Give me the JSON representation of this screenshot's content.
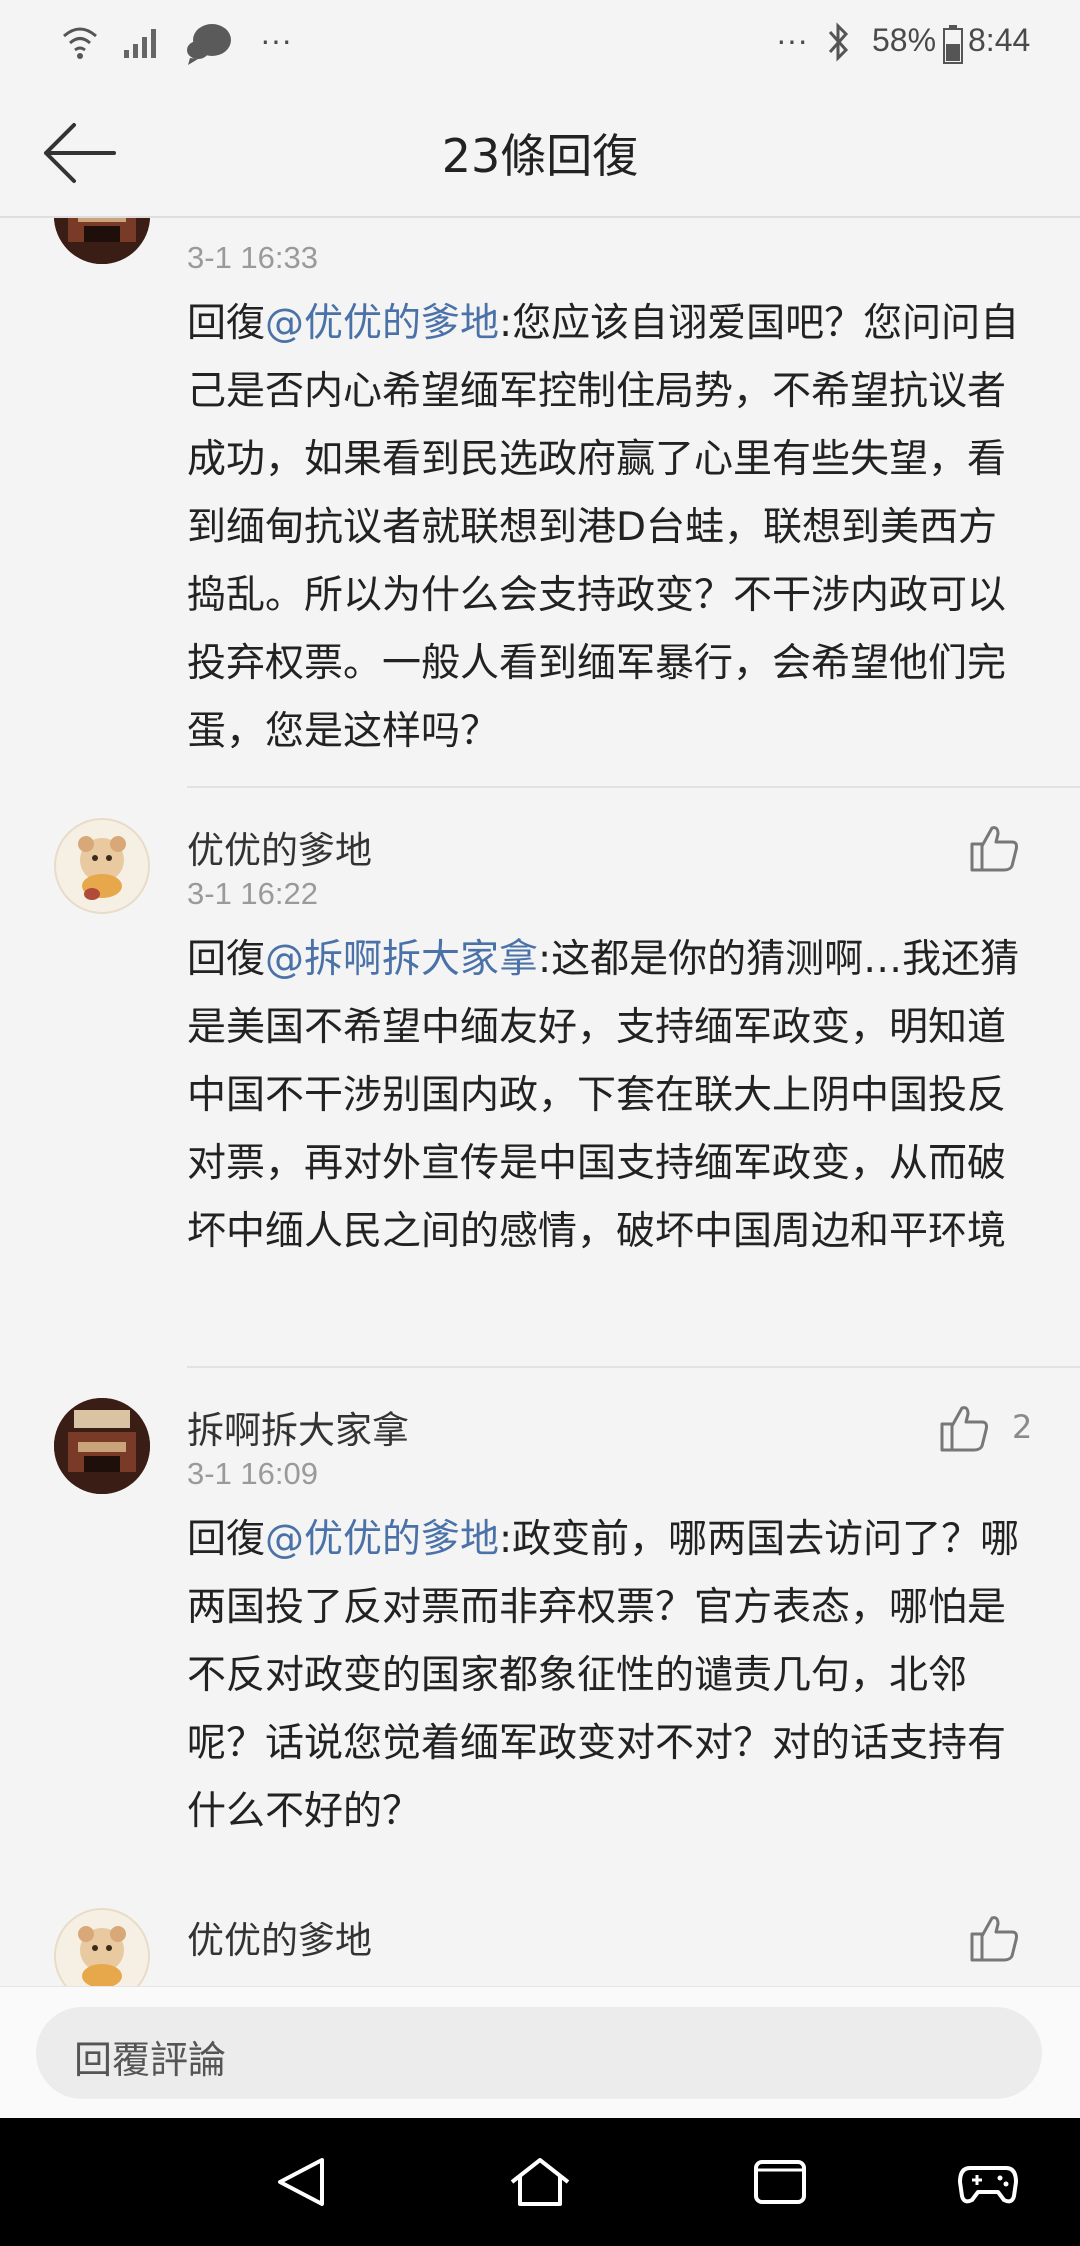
{
  "status_bar": {
    "overflow_left": "···",
    "overflow_right": "···",
    "battery": "58%",
    "time": "8:44"
  },
  "header": {
    "title": "23條回復"
  },
  "comments": [
    {
      "author": "",
      "time": "3-1 16:33",
      "reply_prefix": "回復",
      "mention": "@优优的爹地",
      "text": ":您应该自诩爱国吧？您问问自己是否内心希望缅军控制住局势，不希望抗议者成功，如果看到民选政府赢了心里有些失望，看到缅甸抗议者就联想到港D台蛙，联想到美西方捣乱。所以为什么会支持政变？不干涉内政可以投弃权票。一般人看到缅军暴行，会希望他们完蛋，您是这样吗？",
      "likes": ""
    },
    {
      "author": "优优的爹地",
      "time": "3-1 16:22",
      "reply_prefix": "回復",
      "mention": "@拆啊拆大家拿",
      "text": ":这都是你的猜测啊…我还猜是美国不希望中缅友好，支持缅军政变，明知道中国不干涉别国内政，下套在联大上阴中国投反对票，再对外宣传是中国支持缅军政变，从而破坏中缅人民之间的感情，破坏中国周边和平环境",
      "likes": ""
    },
    {
      "author": "拆啊拆大家拿",
      "time": "3-1 16:09",
      "reply_prefix": "回復",
      "mention": "@优优的爹地",
      "text": ":政变前，哪两国去访问了？哪两国投了反对票而非弃权票？官方表态，哪怕是不反对政变的国家都象征性的谴责几句，北邻呢？话说您觉着缅军政变对不对？对的话支持有什么不好的？",
      "likes": "2"
    },
    {
      "author": "优优的爹地",
      "time": "",
      "reply_prefix": "",
      "mention": "",
      "text": "",
      "likes": ""
    }
  ],
  "reply_bar": {
    "placeholder": "回覆評論"
  },
  "nav_bar": {
    "icons": [
      "back-triangle-icon",
      "home-icon",
      "recents-icon",
      "game-controller-icon"
    ]
  },
  "colors": {
    "background": "#f4f4f4",
    "mention": "#4a72a8",
    "text": "#222222",
    "meta": "#9a9a9a"
  }
}
